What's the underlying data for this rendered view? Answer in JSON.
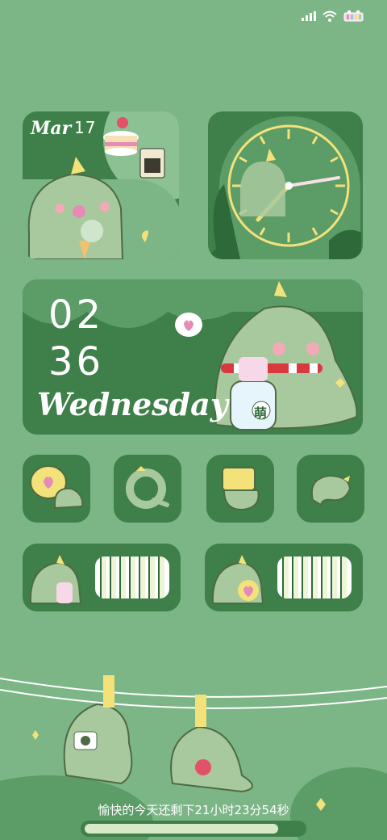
{
  "statusbar": {
    "signal": "signal-icon",
    "wifi": "wifi-icon",
    "battery": "battery-icon"
  },
  "date_widget": {
    "month": "Mar",
    "day": "17"
  },
  "clock_widget": {
    "hour_hand_angle_label": "clock"
  },
  "time_widget": {
    "hour": "02",
    "minute": "36",
    "weekday": "Wednesday",
    "sticker_text": "萌"
  },
  "app_icons": [
    {
      "name": "heart-bubble-dino"
    },
    {
      "name": "ring-dino"
    },
    {
      "name": "box-dino"
    },
    {
      "name": "tail-dino"
    }
  ],
  "bar_widgets": [
    {
      "name": "dino-holding-bottle"
    },
    {
      "name": "dino-holding-heart"
    }
  ],
  "footer": {
    "countdown": "愉快的今天还剩下21小时23分54秒",
    "day_remaining_fraction": 0.89
  },
  "colors": {
    "background": "#7cb586",
    "widget": "#3e7f4a",
    "accent_yellow": "#f3e27a"
  }
}
